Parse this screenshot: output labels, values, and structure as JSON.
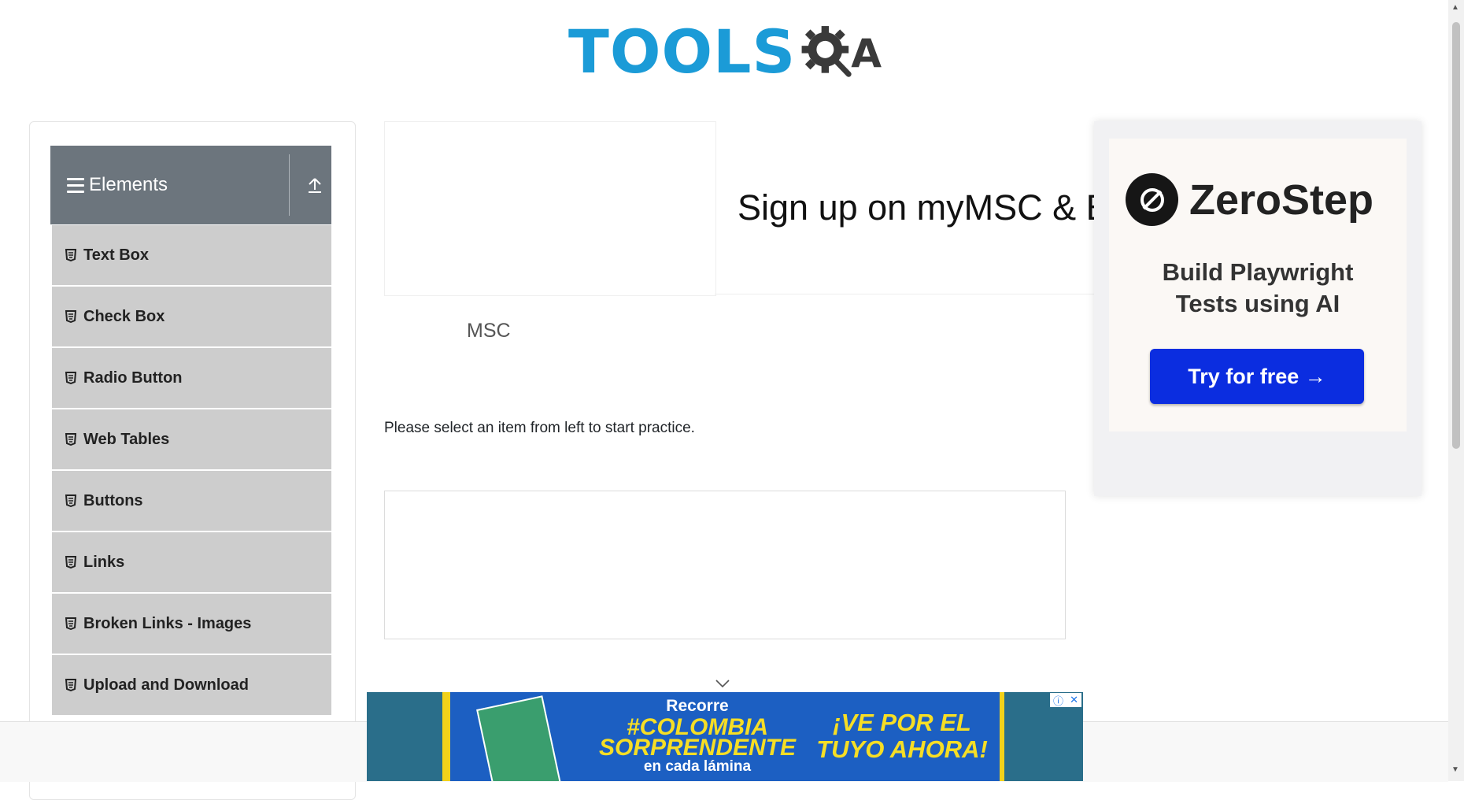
{
  "header": {
    "logo_text": "TOOLS",
    "logo_suffix": "A"
  },
  "sidebar": {
    "group_title": "Elements",
    "items": [
      {
        "label": "Text Box"
      },
      {
        "label": "Check Box"
      },
      {
        "label": "Radio Button"
      },
      {
        "label": "Web Tables"
      },
      {
        "label": "Buttons"
      },
      {
        "label": "Links"
      },
      {
        "label": "Broken Links - Images"
      },
      {
        "label": "Upload and Download"
      }
    ]
  },
  "main": {
    "ad_headline": "Sign up on myMSC & B",
    "ad_brand": "MSC",
    "instruction": "Please select an item from left to start practice."
  },
  "side_ad": {
    "brand": "ZeroStep",
    "tagline_line1": "Build Playwright",
    "tagline_line2": "Tests using AI",
    "cta": "Try for free →"
  },
  "bottom_ad": {
    "line1": "Recorre",
    "line2a": "#COLOMBIA",
    "line2b": "SORPRENDENTE",
    "line3": "en cada lámina",
    "promo_line1": "¡VE POR EL",
    "promo_line2": "TUYO AHORA!"
  },
  "colors": {
    "logo_blue": "#1b9bd7",
    "sidebar_header": "#6c757d",
    "menu_item_bg": "#cdcdcd",
    "cta_blue": "#0b2de0"
  }
}
